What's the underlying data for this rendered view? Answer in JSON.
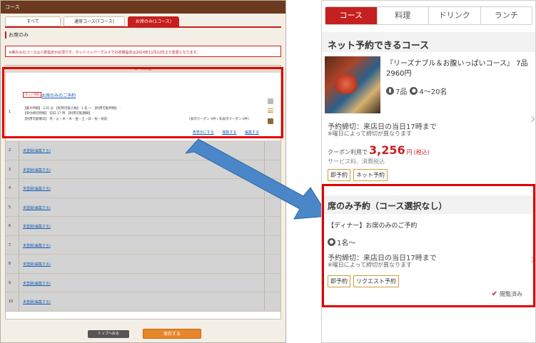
{
  "left": {
    "title": "コース",
    "tabs": [
      "すべて",
      "通常コース(7コース)",
      "お席のみ(1コース)"
    ],
    "section_title": "お席のみ",
    "notice": "※席のみのコースは人数指定が必須です。ホットペッパーグルメでの初期設定は2024年11月22日より変更となります。",
    "table_header": "コース内容",
    "row1": {
      "number": "1",
      "badge": "ネット予約",
      "name": "お席のみのご予約",
      "detail1": "【最大時間】      120 分        【利用可能人数】 1 名 〜        【利用可能時間】  -",
      "detail2": "【受付締切時間】  前日 17 時      【利用可能期間】  -",
      "detail3": "【利用可能曜日】  月・火・水・木・金・土・日・祝・祝前",
      "coupon_note": "(表示クーポン 0件 / 非表示クーポン 0件)",
      "action_preview": "表表示にする",
      "action_copy": "複製する",
      "action_edit": "編集する"
    },
    "empty_rows": [
      {
        "num": "2",
        "link": "未登録(編集する)"
      },
      {
        "num": "3",
        "link": "未登録(編集する)"
      },
      {
        "num": "4",
        "link": "未登録(編集する)"
      },
      {
        "num": "5",
        "link": "未登録(編集する)"
      },
      {
        "num": "6",
        "link": "未登録(編集する)"
      },
      {
        "num": "7",
        "link": "未登録(編集する)"
      },
      {
        "num": "8",
        "link": "未登録(編集する)"
      },
      {
        "num": "9",
        "link": "未登録(編集する)"
      },
      {
        "num": "10",
        "link": "未登録(編集する)"
      }
    ],
    "back_button": "トップへ戻る",
    "save_button": "保存する"
  },
  "right": {
    "tabs": [
      "コース",
      "料理",
      "ドリンク",
      "ランチ"
    ],
    "section1": "ネット予約できるコース",
    "course1": {
      "title": "『リーズナブル＆お腹いっぱいコース』 7品 2960円",
      "items": "7品",
      "people": "4〜20名",
      "deadline": "予約締切：来店日の当日17時まで",
      "deadline_note": "※曜日によって締切が異なります",
      "coupon_label": "クーポン利用で",
      "price": "3,256",
      "yen": "円",
      "tax": "(税込)",
      "service": "サービス料、消費税込",
      "tags": [
        "即予約",
        "ネット予約"
      ]
    },
    "section2": "席のみ予約（コース選択なし）",
    "course2": {
      "title": "【ディナー】お席のみのご予約",
      "people": "1名〜",
      "deadline": "予約締切：来店日の当日17時まで",
      "deadline_note": "※曜日によって締切が異なります",
      "tags": [
        "即予約",
        "リクエスト予約"
      ],
      "viewed": "閲覧済み"
    }
  },
  "colors": {
    "accent": "#c61f1f",
    "header_brown": "#6b3a1f",
    "save_orange": "#e8862a",
    "highlight": "#e00000",
    "arrow": "#4a86c8"
  }
}
